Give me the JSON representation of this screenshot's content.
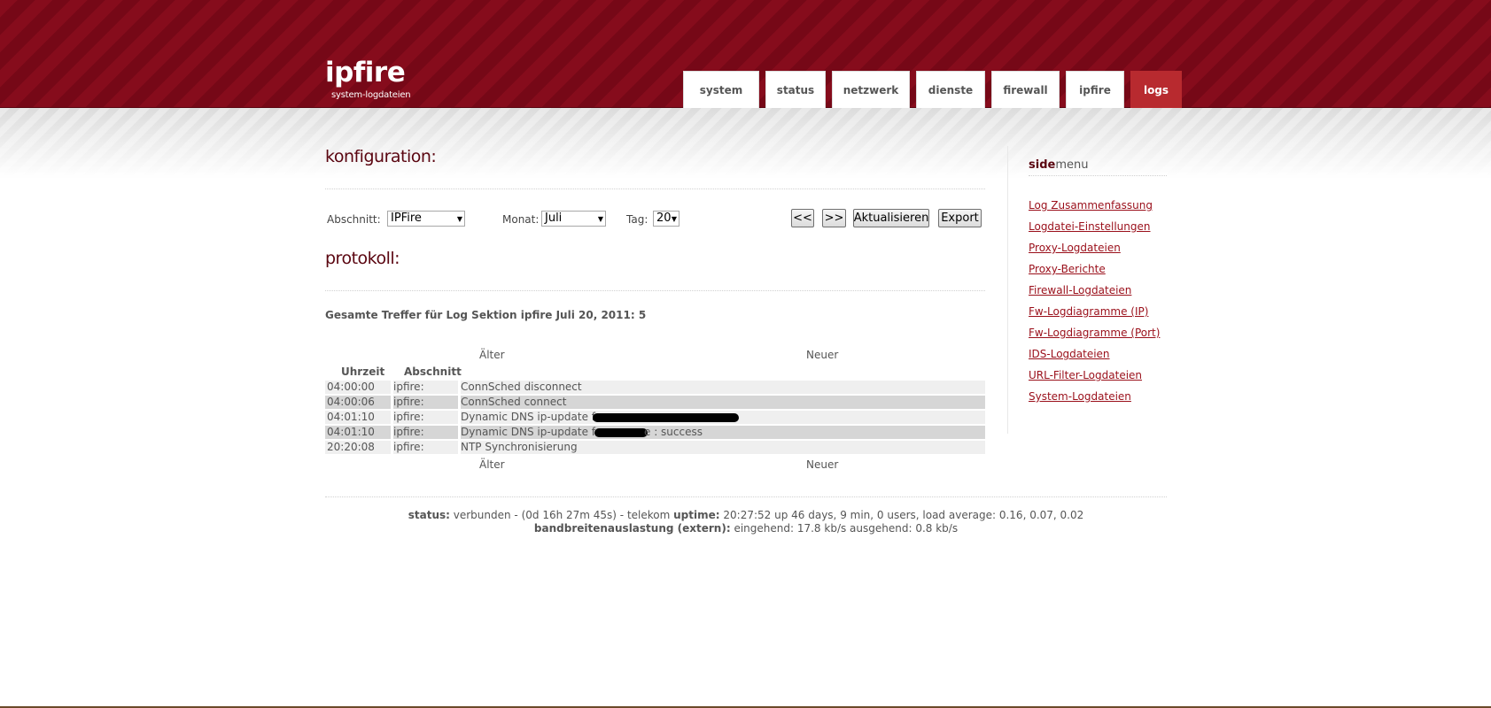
{
  "header": {
    "logo": "ipfire",
    "subtitle": "system-logdateien",
    "tabs": [
      {
        "label": "system",
        "active": false
      },
      {
        "label": "status",
        "active": false
      },
      {
        "label": "netzwerk",
        "active": false
      },
      {
        "label": "dienste",
        "active": false
      },
      {
        "label": "firewall",
        "active": false
      },
      {
        "label": "ipfire",
        "active": false
      },
      {
        "label": "logs",
        "active": true
      }
    ]
  },
  "config": {
    "heading": "konfiguration:",
    "section_label": "Abschnitt:",
    "section_value": "IPFire",
    "month_label": "Monat:",
    "month_value": "Juli",
    "day_label": "Tag:",
    "day_value": "20",
    "prev_button": "<<",
    "next_button": ">>",
    "refresh_button": "Aktualisieren",
    "export_button": "Export"
  },
  "log": {
    "heading": "protokoll:",
    "hits_text": "Gesamte Treffer für Log Sektion ipfire Juli 20, 2011: 5",
    "older": "Älter",
    "newer": "Neuer",
    "col_time": "Uhrzeit",
    "col_section": "Abschnitt",
    "rows": [
      {
        "time": "04:00:00",
        "section": "ipfire:",
        "message": "ConnSched disconnect"
      },
      {
        "time": "04:00:06",
        "section": "ipfire:",
        "message": "ConnSched connect"
      },
      {
        "time": "04:01:10",
        "section": "ipfire:",
        "message": "Dynamic DNS ip-update for"
      },
      {
        "time": "04:01:10",
        "section": "ipfire:",
        "message": "Dynamic DNS ip-update for",
        "suffix": "e : success"
      },
      {
        "time": "20:20:08",
        "section": "ipfire:",
        "message": "NTP Synchronisierung"
      }
    ]
  },
  "sidemenu": {
    "title_bold": "side",
    "title_rest": "menu",
    "links": [
      "Log Zusammenfassung",
      "Logdatei-Einstellungen",
      "Proxy-Logdateien",
      "Proxy-Berichte",
      "Firewall-Logdateien",
      "Fw-Logdiagramme (IP)",
      "Fw-Logdiagramme (Port)",
      "IDS-Logdateien",
      "URL-Filter-Logdateien",
      "System-Logdateien"
    ]
  },
  "footer": {
    "status_label": "status:",
    "status_text": "verbunden - (0d 16h 27m 45s) - telekom",
    "uptime_label": "uptime:",
    "uptime_text": "20:27:52 up 46 days, 9 min, 0 users, load average: 0.16, 0.07, 0.02",
    "bandwidth_label": "bandbreitenauslastung (extern):",
    "bandwidth_text": "eingehend: 17.8 kb/s ausgehend: 0.8 kb/s"
  },
  "colors": {
    "brand": "#7e0a18",
    "active_tab": "#b82a2f",
    "link": "#9a0f1a"
  }
}
